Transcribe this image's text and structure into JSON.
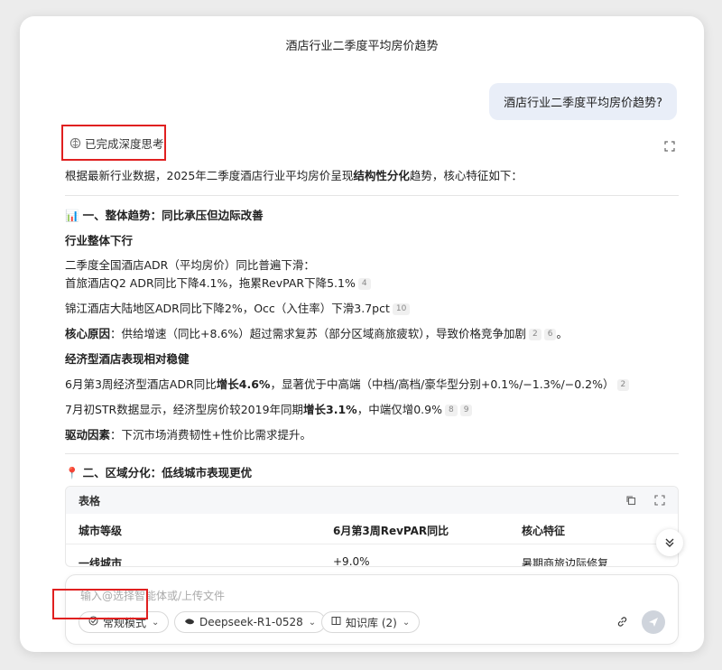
{
  "header": {
    "title": "酒店行业二季度平均房价趋势"
  },
  "user_message": "酒店行业二季度平均房价趋势?",
  "thinking": {
    "label": "已完成深度思考"
  },
  "answer": {
    "intro_pre": "根据最新行业数据，2025年二季度酒店行业平均房价呈现",
    "intro_bold": "结构性分化",
    "intro_post": "趋势，核心特征如下：",
    "section1_icon": "📊",
    "section1_title": "一、整体趋势：同比承压但边际改善",
    "sub1": "行业整体下行",
    "l1": "二季度全国酒店ADR（平均房价）同比普遍下滑：",
    "l2": "首旅酒店Q2 ADR同比下降4.1%，拖累RevPAR下降5.1%",
    "l2_cite": "4",
    "l3": "锦江酒店大陆地区ADR同比下降2%，Occ（入住率）下滑3.7pct",
    "l3_cite": "10",
    "l4_bold": "核心原因",
    "l4": "：供给增速（同比+8.6%）超过需求复苏（部分区域商旅疲软），导致价格竞争加剧",
    "l4_cite1": "2",
    "l4_cite2": "6",
    "l4_end": "。",
    "sub2": "经济型酒店表现相对稳健",
    "l5_pre": "6月第3周经济型酒店ADR同比",
    "l5_bold": "增长4.6%",
    "l5_post": "，显著优于中高端（中档/高档/豪华型分别+0.1%/−1.3%/−0.2%）",
    "l5_cite": "2",
    "l6_pre": "7月初STR数据显示，经济型房价较2019年同期",
    "l6_bold": "增长3.1%",
    "l6_post": "，中端仅增0.9%",
    "l6_cite1": "8",
    "l6_cite2": "9",
    "l7_bold": "驱动因素",
    "l7": "：下沉市场消费韧性+性价比需求提升。",
    "section2_icon": "📍",
    "section2_title": "二、区域分化：低线城市表现更优"
  },
  "table": {
    "label": "表格",
    "columns": [
      "城市等级",
      "6月第3周RevPAR同比",
      "核心特征"
    ],
    "rows": [
      [
        "一线城市",
        "+9.0%",
        "暑期商旅边际修复"
      ]
    ]
  },
  "input": {
    "placeholder": "输入@选择智能体或/上传文件",
    "mode_label": "常规模式",
    "model_label": "Deepseek-R1-0528",
    "kb_label": "知识库 (2)"
  }
}
